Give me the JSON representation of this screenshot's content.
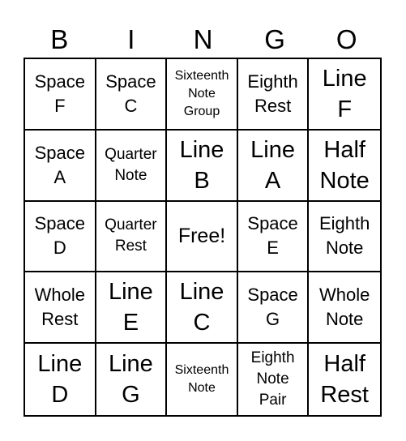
{
  "header": [
    "B",
    "I",
    "N",
    "G",
    "O"
  ],
  "cells": [
    "Space\nF",
    "Space\nC",
    "Sixteenth\nNote\nGroup",
    "Eighth\nRest",
    "Line\nF",
    "Space\nA",
    "Quarter\nNote",
    "Line\nB",
    "Line\nA",
    "Half\nNote",
    "Space\nD",
    "Quarter\nRest",
    "Free!",
    "Space\nE",
    "Eighth\nNote",
    "Whole\nRest",
    "Line\nE",
    "Line\nC",
    "Space\nG",
    "Whole\nNote",
    "Line\nD",
    "Line\nG",
    "Sixteenth\nNote",
    "Eighth\nNote\nPair",
    "Half\nRest"
  ]
}
